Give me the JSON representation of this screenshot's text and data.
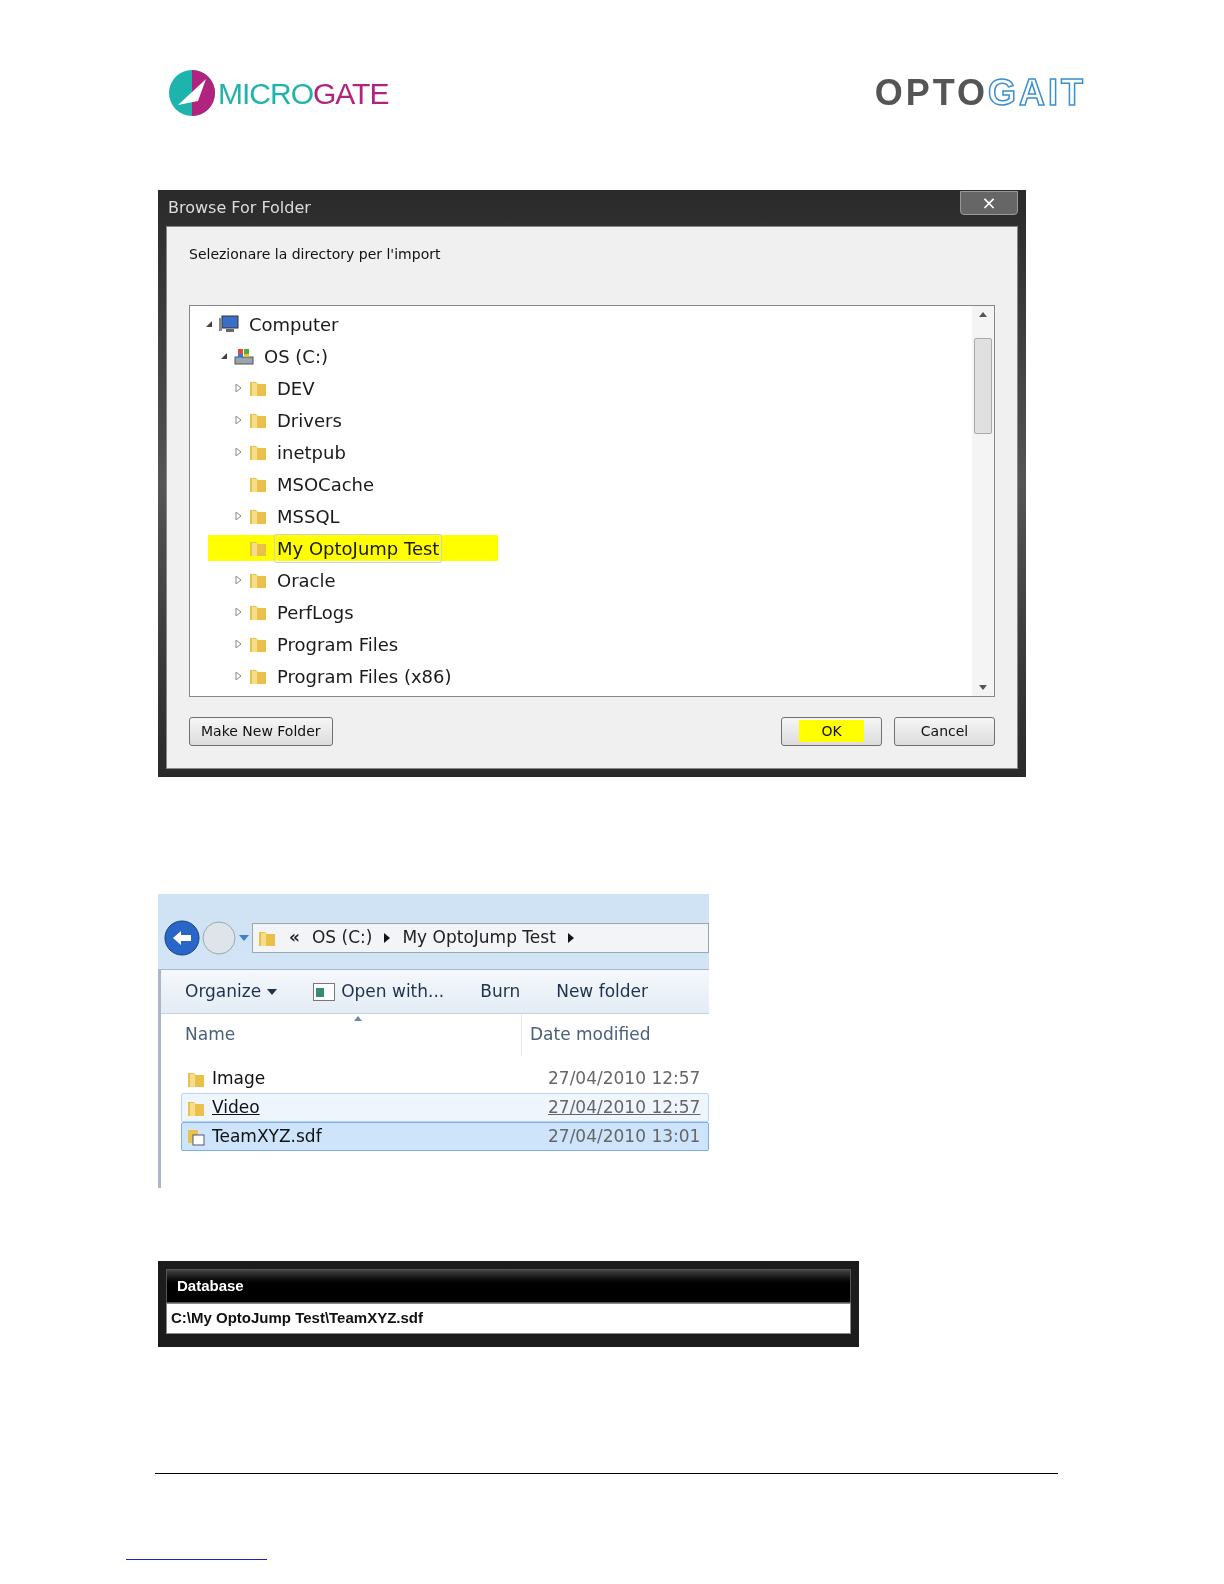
{
  "header": {
    "left_logo": {
      "first": "MICRO",
      "second": "GATE"
    },
    "right_logo": {
      "first": "OPTO",
      "second": "GAIT"
    }
  },
  "dialog": {
    "title": "Browse For Folder",
    "close": "×",
    "prompt": "Selezionare la directory per l'import",
    "tree": [
      {
        "label": "Computer",
        "kind": "computer",
        "expanded": true,
        "children": [
          {
            "label": "OS (C:)",
            "kind": "drive",
            "expanded": true,
            "children": [
              {
                "label": "DEV",
                "kind": "folder",
                "expandable": true,
                "selected": false,
                "highlighted": false
              },
              {
                "label": "Drivers",
                "kind": "folder",
                "expandable": true,
                "selected": false,
                "highlighted": false
              },
              {
                "label": "inetpub",
                "kind": "folder",
                "expandable": true,
                "selected": false,
                "highlighted": false
              },
              {
                "label": "MSOCache",
                "kind": "folder",
                "expandable": false,
                "selected": false,
                "highlighted": false
              },
              {
                "label": "MSSQL",
                "kind": "folder",
                "expandable": true,
                "selected": false,
                "highlighted": false
              },
              {
                "label": "My OptoJump Test",
                "kind": "folder",
                "expandable": false,
                "selected": true,
                "highlighted": true
              },
              {
                "label": "Oracle",
                "kind": "folder",
                "expandable": true,
                "selected": false,
                "highlighted": false
              },
              {
                "label": "PerfLogs",
                "kind": "folder",
                "expandable": true,
                "selected": false,
                "highlighted": false
              },
              {
                "label": "Program Files",
                "kind": "folder",
                "expandable": true,
                "selected": false,
                "highlighted": false
              },
              {
                "label": "Program Files (x86)",
                "kind": "folder",
                "expandable": true,
                "selected": false,
                "highlighted": false
              }
            ]
          }
        ]
      }
    ],
    "buttons": [
      {
        "label": "Make New Folder",
        "highlighted": false
      },
      {
        "label": "OK",
        "highlighted": true
      },
      {
        "label": "Cancel",
        "highlighted": false
      }
    ]
  },
  "explorer": {
    "breadcrumb": {
      "overflow": "«",
      "items": [
        "OS (C:)",
        "My OptoJump Test"
      ]
    },
    "toolbar": [
      {
        "label": "Organize",
        "kind": "menu"
      },
      {
        "label": "Open with...",
        "kind": "icon"
      },
      {
        "label": "Burn",
        "kind": "plain"
      },
      {
        "label": "New folder",
        "kind": "plain"
      }
    ],
    "columns": [
      "Name",
      "Date modified"
    ],
    "rows": [
      {
        "name": "Image",
        "date": "27/04/2010 12:57",
        "kind": "folder",
        "hovered": false,
        "selected": false
      },
      {
        "name": "Video",
        "date": "27/04/2010 12:57",
        "kind": "folder",
        "hovered": true,
        "selected": false
      },
      {
        "name": "TeamXYZ.sdf",
        "date": "27/04/2010 13:01",
        "kind": "file",
        "hovered": false,
        "selected": true
      }
    ]
  },
  "database": {
    "label": "Database",
    "value": "C:\\My OptoJump Test\\TeamXYZ.sdf"
  }
}
